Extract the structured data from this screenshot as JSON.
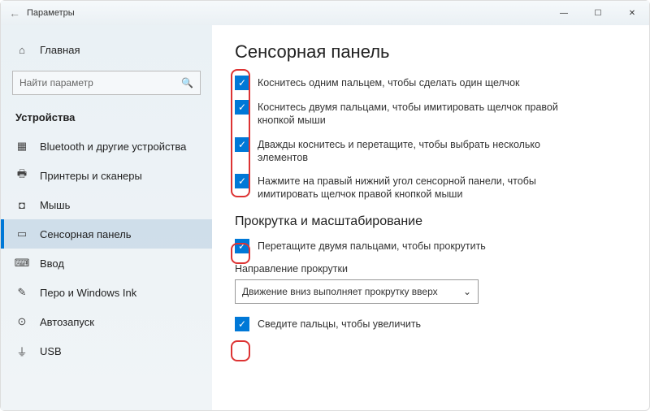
{
  "window": {
    "title": "Параметры"
  },
  "sidebar": {
    "home": "Главная",
    "search_placeholder": "Найти параметр",
    "category": "Устройства",
    "items": [
      {
        "label": "Bluetooth и другие устройства"
      },
      {
        "label": "Принтеры и сканеры"
      },
      {
        "label": "Мышь"
      },
      {
        "label": "Сенсорная панель"
      },
      {
        "label": "Ввод"
      },
      {
        "label": "Перо и Windows Ink"
      },
      {
        "label": "Автозапуск"
      },
      {
        "label": "USB"
      }
    ]
  },
  "main": {
    "heading": "Сенсорная панель",
    "tap_options": [
      "Коснитесь одним пальцем, чтобы сделать один щелчок",
      "Коснитесь двумя пальцами, чтобы имитировать щелчок правой кнопкой мыши",
      "Дважды коснитесь и перетащите, чтобы выбрать несколько элементов",
      "Нажмите на правый нижний угол сенсорной панели, чтобы имитировать щелчок правой кнопкой мыши"
    ],
    "scroll_heading": "Прокрутка и масштабирование",
    "scroll_drag": "Перетащите двумя пальцами, чтобы прокрутить",
    "direction_label": "Направление прокрутки",
    "direction_value": "Движение вниз выполняет прокрутку вверх",
    "pinch": "Сведите пальцы, чтобы увеличить"
  }
}
